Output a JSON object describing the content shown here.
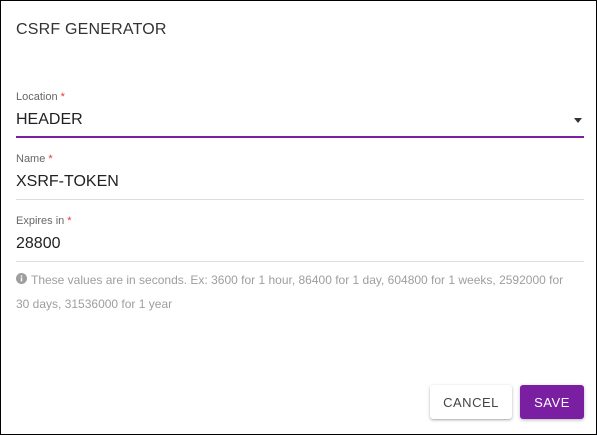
{
  "dialog": {
    "title": "CSRF GENERATOR"
  },
  "fields": {
    "location": {
      "label": "Location",
      "required_mark": "*",
      "value": "HEADER"
    },
    "name": {
      "label": "Name",
      "required_mark": "*",
      "value": "XSRF-TOKEN"
    },
    "expires": {
      "label": "Expires in",
      "required_mark": "*",
      "value": "28800"
    }
  },
  "help": {
    "icon": "info-icon",
    "text": "These values are in seconds. Ex: 3600 for 1 hour, 86400 for 1 day, 604800 for 1 weeks, 2592000 for 30 days, 31536000 for 1 year"
  },
  "actions": {
    "cancel_label": "CANCEL",
    "save_label": "SAVE"
  },
  "colors": {
    "accent": "#7b1fa2",
    "required": "#e53935"
  }
}
